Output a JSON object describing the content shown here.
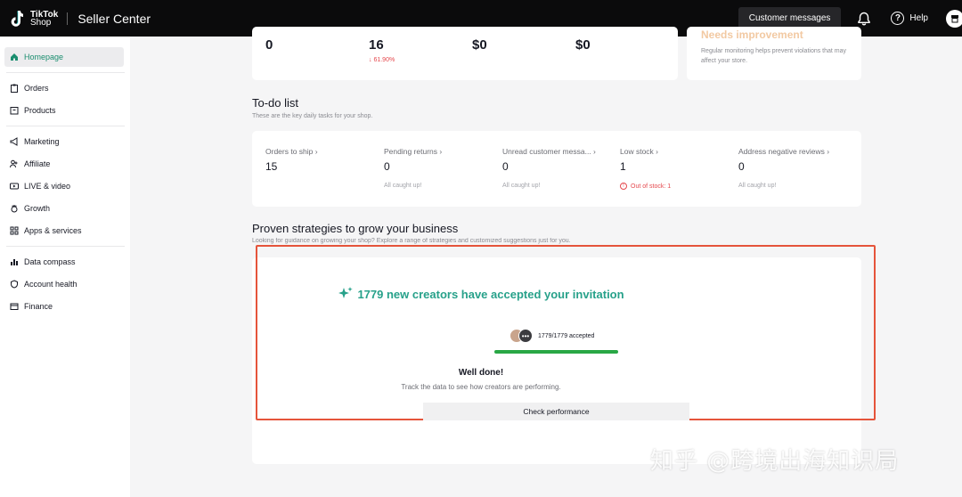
{
  "header": {
    "logo_line1": "TikTok",
    "logo_line2": "Shop",
    "app_title": "Seller Center",
    "customer_messages": "Customer messages",
    "help": "Help"
  },
  "sidebar": {
    "items": [
      {
        "label": "Homepage",
        "icon": "home-icon",
        "active": true
      },
      {
        "label": "Orders",
        "icon": "clipboard-icon"
      },
      {
        "label": "Products",
        "icon": "box-icon"
      },
      {
        "label": "Marketing",
        "icon": "megaphone-icon"
      },
      {
        "label": "Affiliate",
        "icon": "people-icon"
      },
      {
        "label": "LIVE & video",
        "icon": "video-icon"
      },
      {
        "label": "Growth",
        "icon": "sprout-icon"
      },
      {
        "label": "Apps & services",
        "icon": "grid-icon"
      },
      {
        "label": "Data compass",
        "icon": "bar-chart-icon"
      },
      {
        "label": "Account health",
        "icon": "shield-icon"
      },
      {
        "label": "Finance",
        "icon": "wallet-icon"
      }
    ]
  },
  "stats": {
    "v1": "0",
    "v2": "16",
    "v2_delta": "↓ 61.90%",
    "v3": "$0",
    "v4": "$0",
    "health_title": "Needs improvement",
    "health_text": "Regular monitoring helps prevent violations that may affect your store."
  },
  "todo": {
    "title": "To-do list",
    "subtitle": "These are the key daily tasks for your shop.",
    "items": [
      {
        "label": "Orders to ship ›",
        "value": "15",
        "note": ""
      },
      {
        "label": "Pending returns ›",
        "value": "0",
        "note": "All caught up!"
      },
      {
        "label": "Unread customer messa... ›",
        "value": "0",
        "note": "All caught up!"
      },
      {
        "label": "Low stock ›",
        "value": "1",
        "note": "Out of stock: 1"
      },
      {
        "label": "Address negative reviews ›",
        "value": "0",
        "note": "All caught up!"
      }
    ]
  },
  "strategies": {
    "title": "Proven strategies to grow your business",
    "subtitle": "Looking for guidance on growing your shop? Explore a range of strategies and customized suggestions just for you.",
    "invite_title": "1779 new creators have accepted your invitation",
    "accepted": "1779/1779 accepted",
    "progress": 1.0,
    "well_done": "Well done!",
    "track_text": "Track the data to see how creators are performing.",
    "check_button": "Check performance"
  },
  "watermark": "知乎 @跨境出海知识局",
  "colors": {
    "accent": "#1b8e6f",
    "invite": "#27a18a",
    "highlight": "#e5543b",
    "progress": "#29a745",
    "negative": "#e5484d"
  }
}
